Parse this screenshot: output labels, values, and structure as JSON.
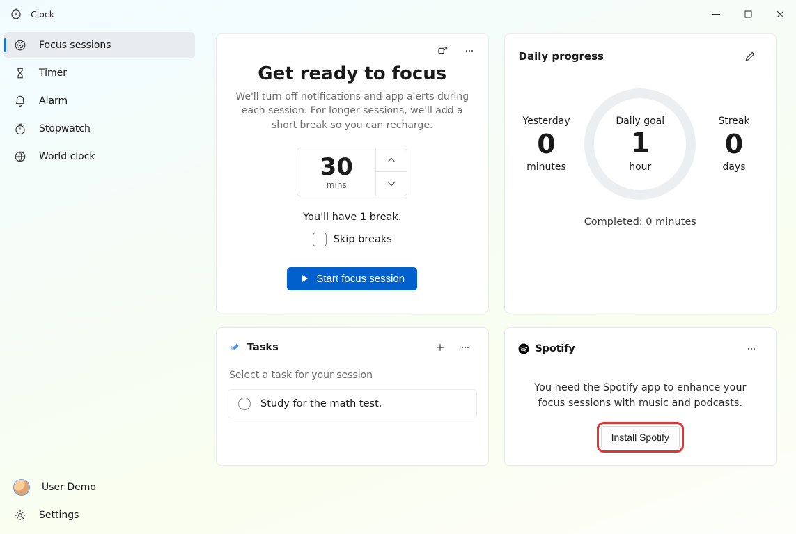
{
  "titlebar": {
    "app_name": "Clock"
  },
  "sidebar": {
    "items": [
      {
        "icon": "focus-sessions-icon",
        "label": "Focus sessions",
        "selected": true
      },
      {
        "icon": "timer-icon",
        "label": "Timer",
        "selected": false
      },
      {
        "icon": "alarm-icon",
        "label": "Alarm",
        "selected": false
      },
      {
        "icon": "stopwatch-icon",
        "label": "Stopwatch",
        "selected": false
      },
      {
        "icon": "world-clock-icon",
        "label": "World clock",
        "selected": false
      }
    ],
    "user_label": "User Demo",
    "settings_label": "Settings"
  },
  "focus": {
    "title": "Get ready to focus",
    "subtitle": "We'll turn off notifications and app alerts during each session. For longer sessions, we'll add a short break so you can recharge.",
    "duration_value": "30",
    "duration_unit": "mins",
    "break_note": "You'll have 1 break.",
    "skip_label": "Skip breaks",
    "start_label": "Start focus session"
  },
  "tasks": {
    "title": "Tasks",
    "select_prompt": "Select a task for your session",
    "items": [
      {
        "label": "Study for the math test."
      }
    ]
  },
  "progress": {
    "title": "Daily progress",
    "yesterday": {
      "label": "Yesterday",
      "value": "0",
      "unit": "minutes"
    },
    "goal": {
      "label": "Daily goal",
      "value": "1",
      "unit": "hour"
    },
    "streak": {
      "label": "Streak",
      "value": "0",
      "unit": "days"
    },
    "completed": "Completed: 0 minutes"
  },
  "spotify": {
    "title": "Spotify",
    "body": "You need the Spotify app to enhance your focus sessions with music and podcasts.",
    "install_label": "Install Spotify"
  }
}
